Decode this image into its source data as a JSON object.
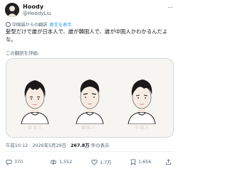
{
  "header": {
    "display_name": "Hoody",
    "handle": "@HoodyLiu",
    "more_icon": "ellipsis-icon"
  },
  "translation": {
    "note": "中国語からの翻訳",
    "show_original": "原文を表示"
  },
  "tweet": {
    "text": "髪型だけで誰が日本人で、誰が韓国人で、誰が中国人かわかるんだよな。"
  },
  "rate_translation": "この翻訳を評価:",
  "media": {
    "faint_labels": [
      "目本人",
      "韓国人",
      "中国人"
    ]
  },
  "meta": {
    "time": "午前10:12",
    "date": "2026年5月29日",
    "views": "267.8万",
    "views_label": "件の表示"
  },
  "actions": {
    "reply_count": "370",
    "repost_count": "1,552",
    "like_count": "1.7万",
    "bookmark_count": "1,656"
  },
  "colors": {
    "accent": "#1d9bf0",
    "secondary_text": "#536471",
    "primary_text": "#0f1419"
  }
}
